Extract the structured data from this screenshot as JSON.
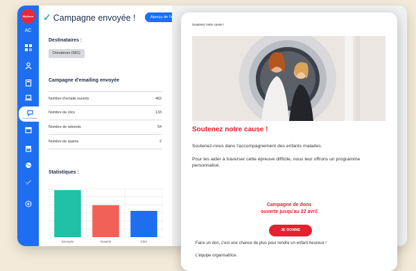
{
  "sidebar": {
    "brand": "MyAzon",
    "initials": "AC",
    "active_label": "Communication",
    "icons": [
      "dashboard-icon",
      "donors-icon",
      "calculator-icon",
      "laptop-icon",
      "communication-icon",
      "calendar-icon",
      "inbox-icon",
      "globe-icon",
      "rocket-icon",
      "add-icon"
    ]
  },
  "header": {
    "title": "Campagne envoyée !",
    "preview_button": "Aperçu de l'email"
  },
  "recipients": {
    "label": "Destinataires :",
    "chip": "Donateurs (681)"
  },
  "campaign": {
    "label": "Campagne d'emailing envoyée",
    "rows": [
      {
        "label": "Nombre d'emails ouverts",
        "value": "462"
      },
      {
        "label": "Nombre de clics",
        "value": "133"
      },
      {
        "label": "Nombre de rebonds",
        "value": "54"
      },
      {
        "label": "Nombre de spams",
        "value": "2"
      }
    ]
  },
  "statistics": {
    "label": "Statistiques :"
  },
  "chart_data": {
    "type": "bar",
    "categories": [
      "Envoyés",
      "Ouverts",
      "Clics"
    ],
    "values": [
      681,
      462,
      380
    ],
    "colors": [
      "#1fc0a6",
      "#f26157",
      "#1e6ef2"
    ],
    "ylim": [
      0,
      700
    ],
    "grid": true
  },
  "email": {
    "top_line": "Soutenez notre cause !",
    "title": "Soutenez notre cause !",
    "p1": "Soutenez-nous dans l'accompagnement des enfants malades.",
    "p2": "Pour les aider à traverser cette épreuve difficile, nous leur offrons un programme personnalisé.",
    "campaign_line1": "Campagne de dons",
    "campaign_line2": "ouverte jusqu'au 22 avril",
    "cta": "JE DONNE",
    "footer1": "Faire un don, c'est une chance de plus pour rendre un enfant heureux !",
    "footer2": "L'équipe organisatrice."
  }
}
